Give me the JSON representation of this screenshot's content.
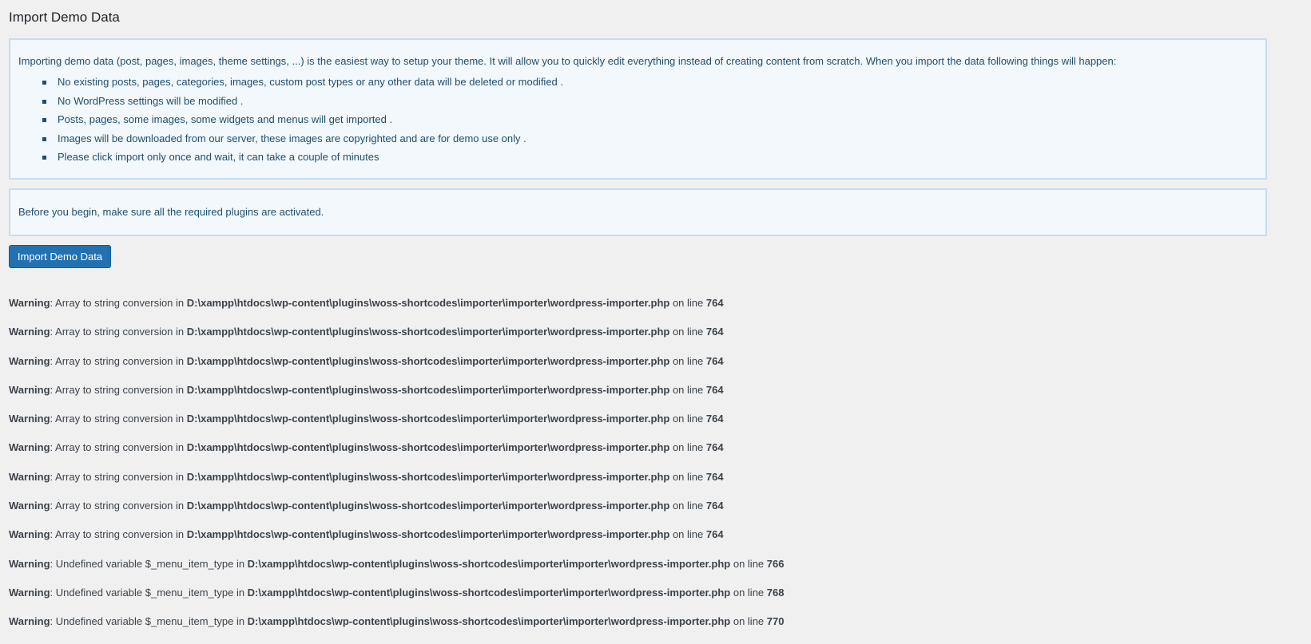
{
  "page": {
    "title": "Import Demo Data"
  },
  "intro_notice": {
    "paragraph": "Importing demo data (post, pages, images, theme settings, ...) is the easiest way to setup your theme. It will allow you to quickly edit everything instead of creating content from scratch. When you import the data following things will happen:",
    "items": [
      "No existing posts, pages, categories, images, custom post types or any other data will be deleted or modified .",
      "No WordPress settings will be modified .",
      "Posts, pages, some images, some widgets and menus will get imported .",
      "Images will be downloaded from our server, these images are copyrighted and are for demo use only .",
      "Please click import only once and wait, it can take a couple of minutes"
    ]
  },
  "before_notice": {
    "text": "Before you begin, make sure all the required plugins are activated."
  },
  "import_button": {
    "label": "Import Demo Data"
  },
  "warnings": [
    {
      "label": "Warning",
      "message": ": Array to string conversion in ",
      "path": "D:\\xampp\\htdocs\\wp-content\\plugins\\woss-shortcodes\\importer\\importer\\wordpress-importer.php",
      "on_line": " on line ",
      "line": "764"
    },
    {
      "label": "Warning",
      "message": ": Array to string conversion in ",
      "path": "D:\\xampp\\htdocs\\wp-content\\plugins\\woss-shortcodes\\importer\\importer\\wordpress-importer.php",
      "on_line": " on line ",
      "line": "764"
    },
    {
      "label": "Warning",
      "message": ": Array to string conversion in ",
      "path": "D:\\xampp\\htdocs\\wp-content\\plugins\\woss-shortcodes\\importer\\importer\\wordpress-importer.php",
      "on_line": " on line ",
      "line": "764"
    },
    {
      "label": "Warning",
      "message": ": Array to string conversion in ",
      "path": "D:\\xampp\\htdocs\\wp-content\\plugins\\woss-shortcodes\\importer\\importer\\wordpress-importer.php",
      "on_line": " on line ",
      "line": "764"
    },
    {
      "label": "Warning",
      "message": ": Array to string conversion in ",
      "path": "D:\\xampp\\htdocs\\wp-content\\plugins\\woss-shortcodes\\importer\\importer\\wordpress-importer.php",
      "on_line": " on line ",
      "line": "764"
    },
    {
      "label": "Warning",
      "message": ": Array to string conversion in ",
      "path": "D:\\xampp\\htdocs\\wp-content\\plugins\\woss-shortcodes\\importer\\importer\\wordpress-importer.php",
      "on_line": " on line ",
      "line": "764"
    },
    {
      "label": "Warning",
      "message": ": Array to string conversion in ",
      "path": "D:\\xampp\\htdocs\\wp-content\\plugins\\woss-shortcodes\\importer\\importer\\wordpress-importer.php",
      "on_line": " on line ",
      "line": "764"
    },
    {
      "label": "Warning",
      "message": ": Array to string conversion in ",
      "path": "D:\\xampp\\htdocs\\wp-content\\plugins\\woss-shortcodes\\importer\\importer\\wordpress-importer.php",
      "on_line": " on line ",
      "line": "764"
    },
    {
      "label": "Warning",
      "message": ": Array to string conversion in ",
      "path": "D:\\xampp\\htdocs\\wp-content\\plugins\\woss-shortcodes\\importer\\importer\\wordpress-importer.php",
      "on_line": " on line ",
      "line": "764"
    },
    {
      "label": "Warning",
      "message": ": Undefined variable $_menu_item_type in ",
      "path": "D:\\xampp\\htdocs\\wp-content\\plugins\\woss-shortcodes\\importer\\importer\\wordpress-importer.php",
      "on_line": " on line ",
      "line": "766"
    },
    {
      "label": "Warning",
      "message": ": Undefined variable $_menu_item_type in ",
      "path": "D:\\xampp\\htdocs\\wp-content\\plugins\\woss-shortcodes\\importer\\importer\\wordpress-importer.php",
      "on_line": " on line ",
      "line": "768"
    },
    {
      "label": "Warning",
      "message": ": Undefined variable $_menu_item_type in ",
      "path": "D:\\xampp\\htdocs\\wp-content\\plugins\\woss-shortcodes\\importer\\importer\\wordpress-importer.php",
      "on_line": " on line ",
      "line": "770"
    }
  ]
}
